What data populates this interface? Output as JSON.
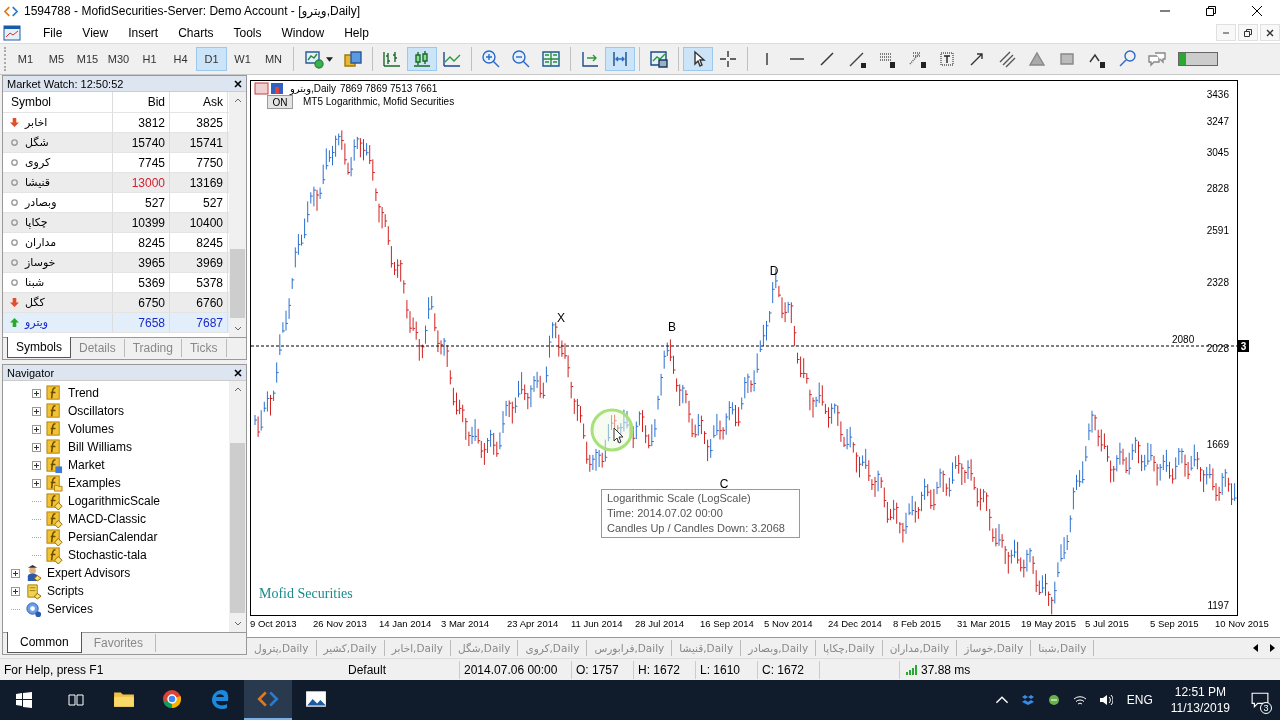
{
  "window": {
    "title": "1594788 - MofidSecurities-Server: Demo Account - [ویترو,Daily]"
  },
  "menu": [
    "File",
    "View",
    "Insert",
    "Charts",
    "Tools",
    "Window",
    "Help"
  ],
  "timeframes": [
    {
      "label": "M1",
      "selected": false
    },
    {
      "label": "M5",
      "selected": false
    },
    {
      "label": "M15",
      "selected": false
    },
    {
      "label": "M30",
      "selected": false
    },
    {
      "label": "H1",
      "selected": false
    },
    {
      "label": "H4",
      "selected": false
    },
    {
      "label": "D1",
      "selected": true
    },
    {
      "label": "W1",
      "selected": false
    },
    {
      "label": "MN",
      "selected": false
    }
  ],
  "tools": [
    {
      "selected": false
    },
    {
      "selected": false
    },
    {
      "selected": false
    },
    {
      "selected": true
    },
    {
      "selected": false
    },
    {
      "selected": false
    },
    {
      "selected": false
    },
    {
      "selected": false
    },
    {
      "selected": false
    },
    {
      "selected": true
    },
    {
      "selected": false
    },
    {
      "selected": true
    },
    {
      "selected": false
    },
    {
      "selected": false
    },
    {
      "selected": false
    },
    {
      "selected": false
    },
    {
      "selected": false
    },
    {
      "selected": false
    },
    {
      "selected": false
    },
    {
      "selected": false
    },
    {
      "selected": false
    },
    {
      "selected": false
    },
    {
      "selected": false
    },
    {
      "selected": false
    },
    {
      "selected": false
    },
    {
      "selected": false
    },
    {
      "selected": false
    }
  ],
  "connection_meter": {
    "level": 0.18
  },
  "market_watch": {
    "title": "Market Watch: 12:50:52",
    "columns": [
      "Symbol",
      "Bid",
      "Ask"
    ],
    "rows": [
      {
        "symbol": "اخابر",
        "bid": "3812",
        "ask": "3825",
        "kind": "down",
        "bid_falling": false,
        "selected": false
      },
      {
        "symbol": "شگل",
        "bid": "15740",
        "ask": "15741",
        "kind": "flat",
        "bid_falling": false,
        "selected": false
      },
      {
        "symbol": "کروی",
        "bid": "7745",
        "ask": "7750",
        "kind": "flat",
        "bid_falling": false,
        "selected": false
      },
      {
        "symbol": "قنیشا",
        "bid": "13000",
        "ask": "13169",
        "kind": "flat",
        "bid_falling": true,
        "selected": false
      },
      {
        "symbol": "وبصادر",
        "bid": "527",
        "ask": "527",
        "kind": "flat",
        "bid_falling": false,
        "selected": false
      },
      {
        "symbol": "چکاپا",
        "bid": "10399",
        "ask": "10400",
        "kind": "flat",
        "bid_falling": false,
        "selected": false
      },
      {
        "symbol": "مداران",
        "bid": "8245",
        "ask": "8245",
        "kind": "flat",
        "bid_falling": false,
        "selected": false
      },
      {
        "symbol": "خوساز",
        "bid": "3965",
        "ask": "3969",
        "kind": "flat",
        "bid_falling": false,
        "selected": false
      },
      {
        "symbol": "شبنا",
        "bid": "5369",
        "ask": "5378",
        "kind": "flat",
        "bid_falling": false,
        "selected": false
      },
      {
        "symbol": "کگل",
        "bid": "6750",
        "ask": "6760",
        "kind": "down",
        "bid_falling": false,
        "selected": false
      },
      {
        "symbol": "ویترو",
        "bid": "7658",
        "ask": "7687",
        "kind": "up",
        "bid_falling": false,
        "selected": true
      }
    ],
    "tabs": [
      {
        "label": "Symbols",
        "selected": true
      },
      {
        "label": "Details",
        "selected": false
      },
      {
        "label": "Trading",
        "selected": false
      },
      {
        "label": "Ticks",
        "selected": false
      }
    ]
  },
  "navigator": {
    "title": "Navigator",
    "items": [
      {
        "children": [
          {
            "label": "Trend",
            "kind": "indicator-group",
            "expanded": false
          },
          {
            "label": "Oscillators",
            "kind": "indicator-group",
            "expanded": false
          },
          {
            "label": "Volumes",
            "kind": "indicator-group",
            "expanded": false
          },
          {
            "label": "Bill Williams",
            "kind": "indicator-group",
            "expanded": false
          },
          {
            "label": "Market",
            "kind": "market",
            "expanded": false
          },
          {
            "label": "Examples",
            "kind": "examples",
            "expanded": false
          },
          {
            "label": "LogarithmicScale",
            "kind": "indicator"
          },
          {
            "label": "MACD-Classic",
            "kind": "indicator"
          },
          {
            "label": "PersianCalendar",
            "kind": "indicator"
          },
          {
            "label": "Stochastic-tala",
            "kind": "indicator"
          }
        ]
      },
      {
        "label": "Expert Advisors",
        "kind": "experts",
        "expanded": false
      },
      {
        "label": "Scripts",
        "kind": "scripts",
        "expanded": false
      },
      {
        "label": "Services",
        "kind": "services"
      }
    ],
    "tabs": [
      {
        "label": "Common",
        "selected": true
      },
      {
        "label": "Favorites",
        "selected": false
      }
    ]
  },
  "chart": {
    "symbol": "ویترو,Daily",
    "ohlc": "7869 7869 7513 7661",
    "indicator_button": "ON",
    "indicator_name": "MT5 Logarithmic, Mofid Securities",
    "price_labels": [
      "3436",
      "3247",
      "3045",
      "2828",
      "2591",
      "2328",
      "2028",
      "1669",
      "1197"
    ],
    "date_labels": [
      "9 Oct 2013",
      "26 Nov 2013",
      "14 Jan 2014",
      "3 Mar 2014",
      "23 Apr 2014",
      "11 Jun 2014",
      "28 Jul 2014",
      "16 Sep 2014",
      "5 Nov 2014",
      "24 Dec 2014",
      "8 Feb 2015",
      "31 Mar 2015",
      "19 May 2015",
      "5 Jul 2015",
      "5 Sep 2015",
      "10 Nov 2015"
    ],
    "pattern_points": [
      "X",
      "B",
      "C",
      "D"
    ],
    "level_line": {
      "label": "2080",
      "marker": "3"
    },
    "tooltip": [
      "Logarithmic Scale (LogScale)",
      "Time: 2014.07.02 00:00",
      "Candles Up / Candles Down: 3.2068"
    ],
    "caption": "Mofid Securities"
  },
  "chart_tabs": [
    "پترول,Daily",
    "کشیر,Daily",
    "اخابر,Daily",
    "شگل,Daily",
    "کروی,Daily",
    "فرابورس,Daily",
    "قنیشا,Daily",
    "وبصادر,Daily",
    "چکاپا,Daily",
    "مداران,Daily",
    "خوساز,Daily",
    "شبنا,Daily"
  ],
  "status_bar": {
    "help": "For Help, press F1",
    "profile": "Default",
    "time": "2014.07.06 00:00",
    "open": "O: 1757",
    "high": "H: 1672",
    "low": "L: 1610",
    "close": "C: 1672",
    "ping": "37.88 ms"
  },
  "taskbar": {
    "apps": [
      {
        "selected": false
      },
      {
        "selected": false
      },
      {
        "selected": false
      },
      {
        "selected": true
      },
      {
        "selected": false
      }
    ],
    "language": "ENG",
    "time": "12:51 PM",
    "date": "11/13/2019",
    "notifications": "3"
  }
}
